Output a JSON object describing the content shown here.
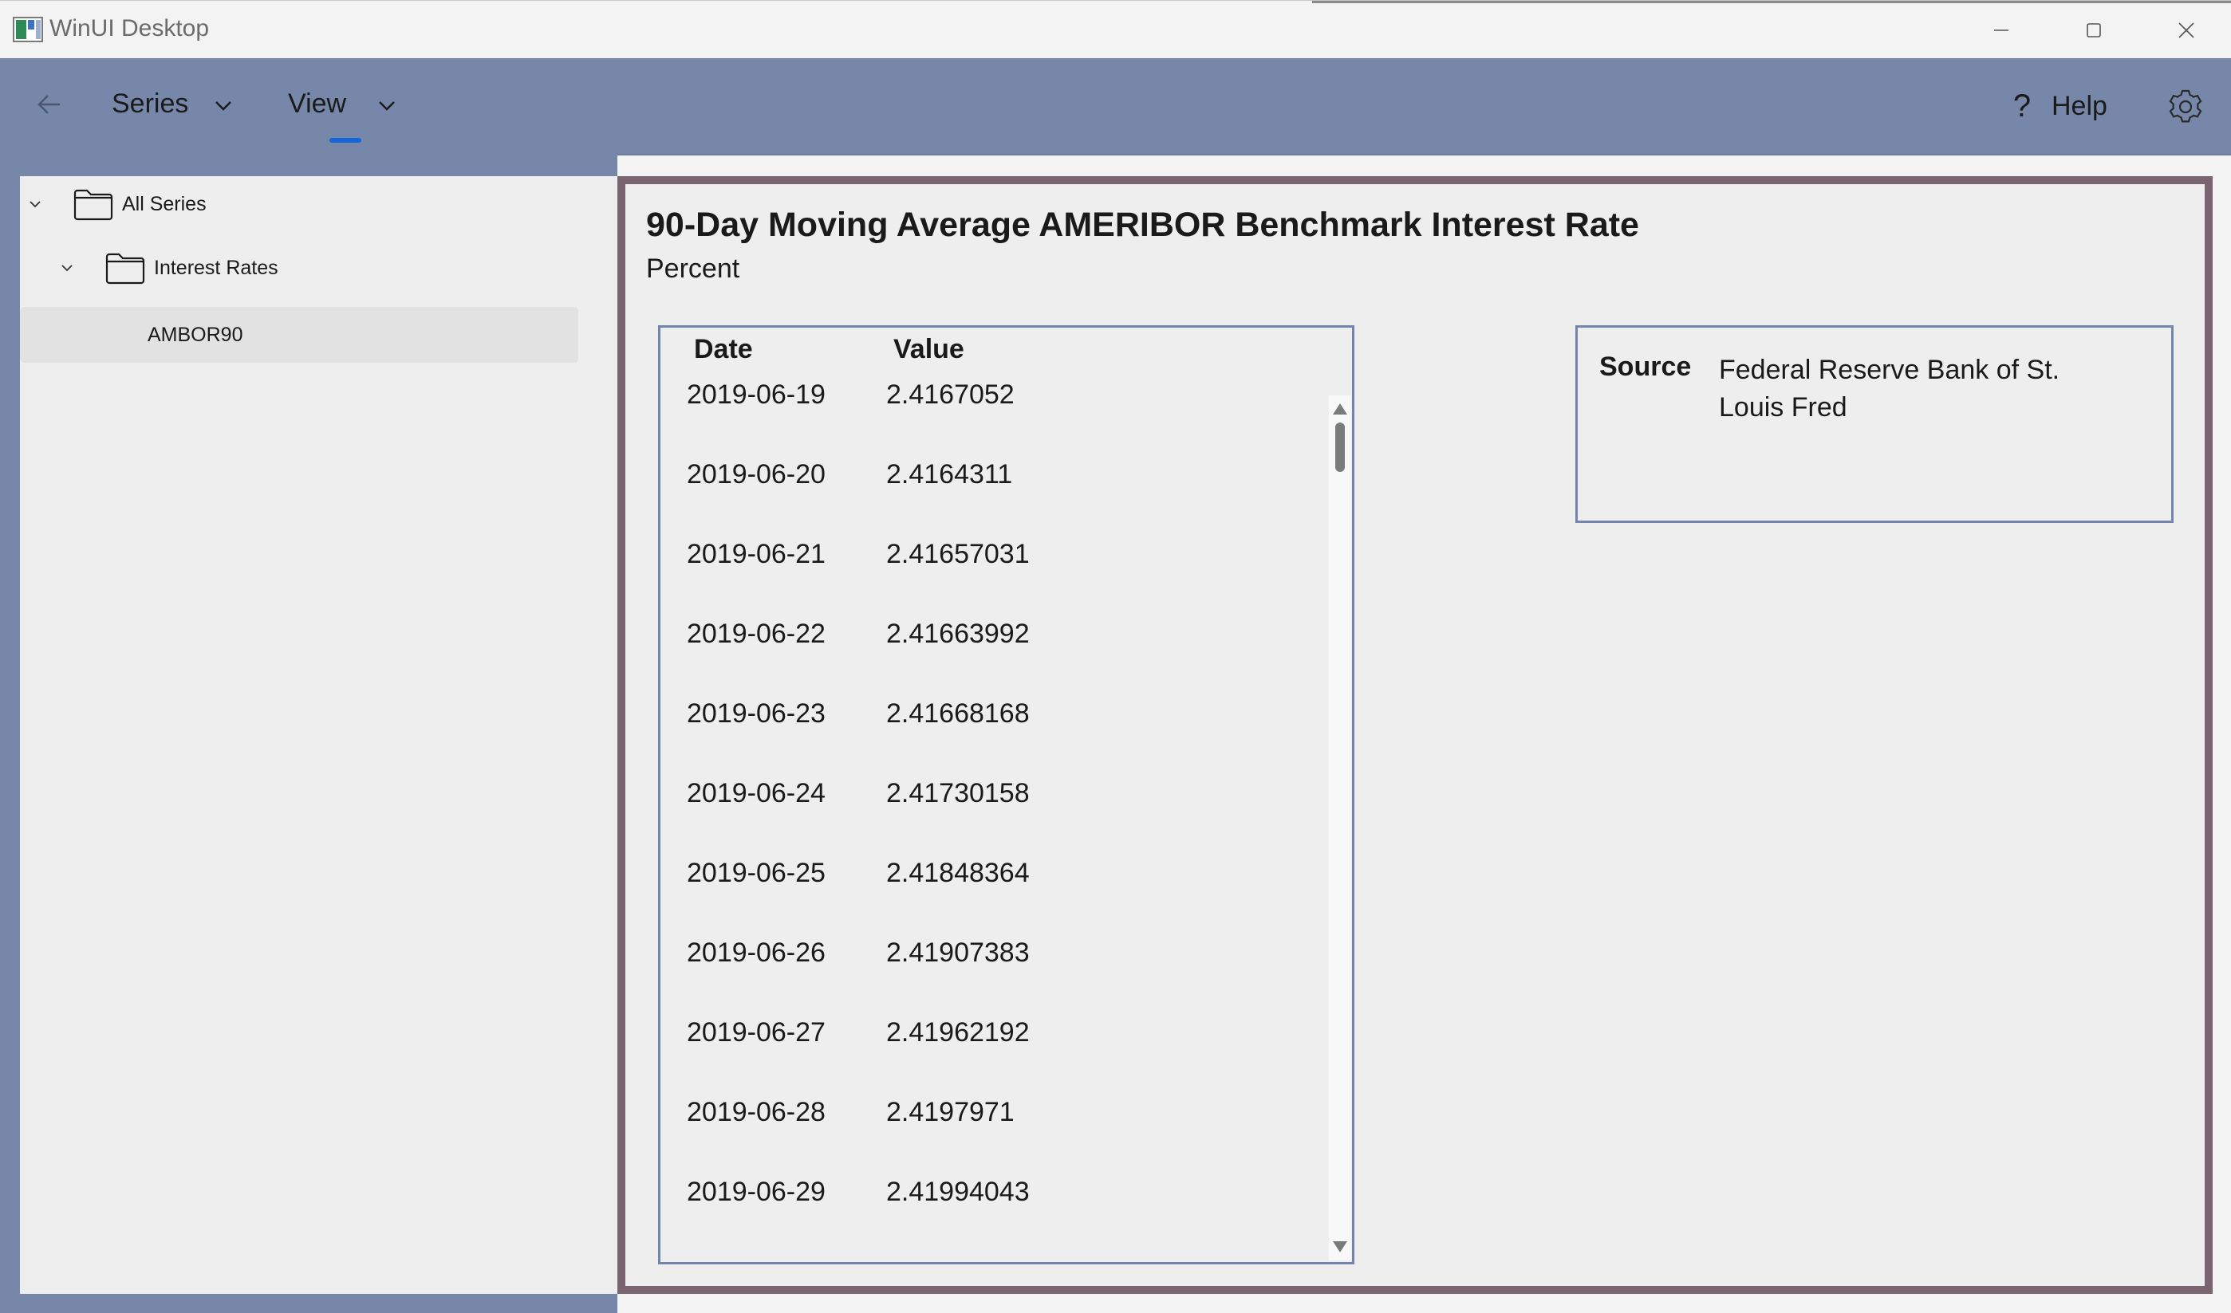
{
  "window": {
    "title": "WinUI Desktop",
    "icons": [
      "app-icon",
      "minimize-icon",
      "maximize-icon",
      "close-icon"
    ]
  },
  "menu": {
    "back_icon": "arrow-left-icon",
    "items": [
      {
        "label": "Series",
        "icon": "chevron-down-icon"
      },
      {
        "label": "View",
        "icon": "chevron-down-icon",
        "selected": true
      }
    ],
    "help_label": "Help",
    "help_icon": "question-mark",
    "settings_icon": "gear-icon",
    "accent_color": "#1565d8",
    "bar_color": "#7687aa"
  },
  "tree": {
    "nodes": [
      {
        "label": "All Series",
        "level": 0,
        "expanded": true,
        "icon": "folder-icon"
      },
      {
        "label": "Interest Rates",
        "level": 1,
        "expanded": true,
        "icon": "folder-icon"
      },
      {
        "label": "AMBOR90",
        "level": 2,
        "selected": true
      }
    ]
  },
  "series": {
    "title": "90-Day Moving Average AMERIBOR Benchmark Interest Rate",
    "units": "Percent"
  },
  "table": {
    "headers": {
      "date": "Date",
      "value": "Value"
    },
    "rows": [
      {
        "date": "2019-06-19",
        "value": "2.4167052"
      },
      {
        "date": "2019-06-20",
        "value": "2.4164311"
      },
      {
        "date": "2019-06-21",
        "value": "2.41657031"
      },
      {
        "date": "2019-06-22",
        "value": "2.41663992"
      },
      {
        "date": "2019-06-23",
        "value": "2.41668168"
      },
      {
        "date": "2019-06-24",
        "value": "2.41730158"
      },
      {
        "date": "2019-06-25",
        "value": "2.41848364"
      },
      {
        "date": "2019-06-26",
        "value": "2.41907383"
      },
      {
        "date": "2019-06-27",
        "value": "2.41962192"
      },
      {
        "date": "2019-06-28",
        "value": "2.4197971"
      },
      {
        "date": "2019-06-29",
        "value": "2.41994043"
      }
    ]
  },
  "source": {
    "label": "Source",
    "value": "Federal Reserve Bank of St. Louis Fred"
  }
}
